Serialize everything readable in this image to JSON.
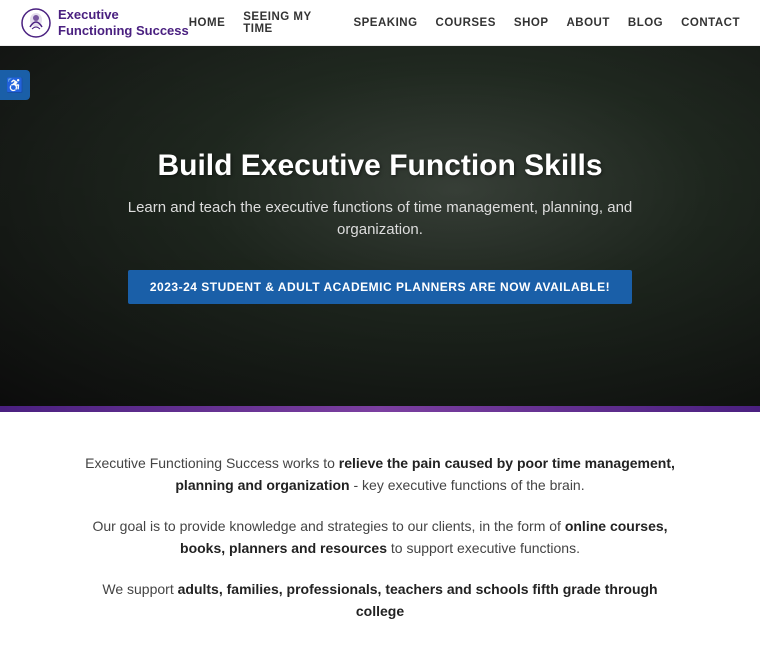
{
  "header": {
    "logo_line1": "Executive",
    "logo_line2": "Functioning Success",
    "nav_items": [
      {
        "label": "HOME",
        "id": "home"
      },
      {
        "label": "SEEING MY TIME",
        "id": "seeing-my-time"
      },
      {
        "label": "SPEAKING",
        "id": "speaking"
      },
      {
        "label": "COURSES",
        "id": "courses"
      },
      {
        "label": "SHOP",
        "id": "shop"
      },
      {
        "label": "ABOUT",
        "id": "about"
      },
      {
        "label": "BLOG",
        "id": "blog"
      },
      {
        "label": "CONTACT",
        "id": "contact"
      }
    ]
  },
  "accessibility": {
    "icon": "♿",
    "label": "Accessibility"
  },
  "hero": {
    "title": "Build Executive Function Skills",
    "subtitle": "Learn and teach the executive functions of time management, planning, and organization.",
    "cta_label": "2023-24 STUDENT & ADULT ACADEMIC PLANNERS ARE NOW AVAILABLE!"
  },
  "content": {
    "paragraph1_pre": "Executive Functioning Success works to ",
    "paragraph1_bold": "relieve the pain caused by poor time management, planning and organization",
    "paragraph1_post": " - key executive functions of the brain.",
    "paragraph2_pre": "Our goal is to provide knowledge and strategies to our clients, in the form of ",
    "paragraph2_bold": "online courses, books, planners and resources",
    "paragraph2_post": " to support executive functions.",
    "paragraph3_pre": "We support ",
    "paragraph3_bold": "adults, families, professionals, teachers and schools fifth grade through college"
  }
}
